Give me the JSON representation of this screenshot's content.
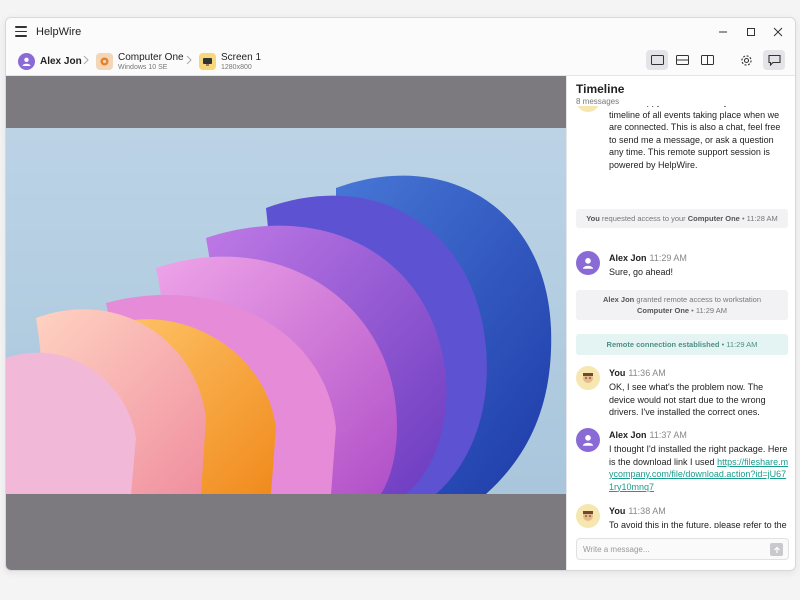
{
  "app": {
    "title": "HelpWire"
  },
  "breadcrumb": {
    "user": {
      "name": "Alex Jon"
    },
    "computer": {
      "name": "Computer One",
      "os": "Windows 10 SE"
    },
    "screen": {
      "name": "Screen 1",
      "resolution": "1280x800"
    }
  },
  "toolbar": {
    "icons": [
      "single-view-icon",
      "split-horizontal-icon",
      "split-vertical-icon",
      "gear-icon",
      "chat-icon"
    ],
    "active_view": "single-view"
  },
  "window_controls": [
    "minimize-icon",
    "maximize-icon",
    "close-icon"
  ],
  "timeline": {
    "title": "Timeline",
    "count": "8 messages",
    "first_partial": "Hi! I'm happy to assist. Here you'll see the timeline of all events taking place when we are connected. This is also a chat, feel free to send me a message, or ask a question any time. This remote support session is powered by HelpWire.",
    "events": [
      {
        "type": "system",
        "pre": "You",
        "mid": " requested access to your ",
        "strong": "Computer One",
        "time": " • 11:28 AM"
      },
      {
        "type": "message",
        "author": "Alex Jon",
        "time": "11:29 AM",
        "text": "Sure, go ahead!"
      },
      {
        "type": "system",
        "pre": "Alex Jon",
        "mid": " granted remote access to workstation ",
        "strong": "Computer One",
        "time": " • 11:29 AM"
      },
      {
        "type": "system-green",
        "pre": "Remote connection established",
        "time": " • 11:29 AM"
      },
      {
        "type": "message",
        "author": "You",
        "time": "11:36 AM",
        "text": "OK, I see what's the problem now. The device would not start due to the wrong drivers. I've installed the correct ones."
      },
      {
        "type": "message",
        "author": "Alex Jon",
        "time": "11:37 AM",
        "text": "I thought I'd installed the right package. Here is the download link I used ",
        "link": "https://fileshare.mycompany.com/file/download.action?id=jU671ry10mnq7"
      },
      {
        "type": "message",
        "author": "You",
        "time": "11:38 AM",
        "text": "To avoid this in the future, please refer to the user guide."
      }
    ]
  },
  "compose": {
    "placeholder": "Write a message..."
  },
  "colors": {
    "accent": "#8a6bd6",
    "link": "#1a9c8c",
    "remote_bg": "#7c7a7e"
  }
}
